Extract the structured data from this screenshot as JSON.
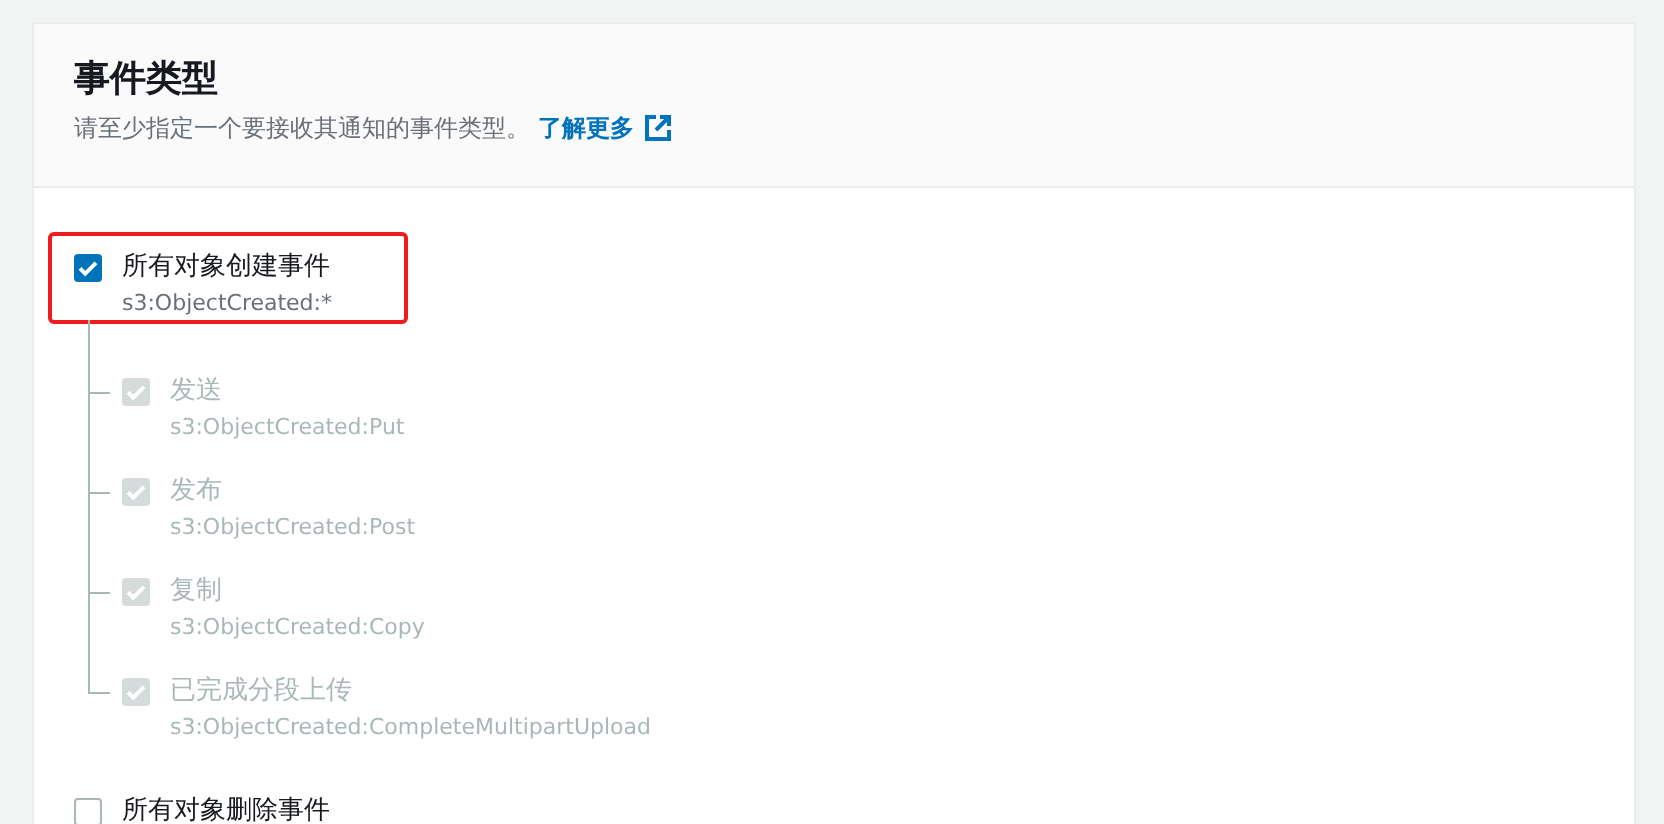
{
  "section": {
    "title": "事件类型",
    "description": "请至少指定一个要接收其通知的事件类型。",
    "link": "了解更多"
  },
  "event_groups": [
    {
      "label": "所有对象创建事件",
      "code": "s3:ObjectCreated:*",
      "checked": true,
      "disabled": false,
      "highlighted": true,
      "children": [
        {
          "label": "发送",
          "code": "s3:ObjectCreated:Put",
          "checked": true,
          "disabled": true
        },
        {
          "label": "发布",
          "code": "s3:ObjectCreated:Post",
          "checked": true,
          "disabled": true
        },
        {
          "label": "复制",
          "code": "s3:ObjectCreated:Copy",
          "checked": true,
          "disabled": true
        },
        {
          "label": "已完成分段上传",
          "code": "s3:ObjectCreated:CompleteMultipartUpload",
          "checked": true,
          "disabled": true
        }
      ]
    },
    {
      "label": "所有对象删除事件",
      "checked": false,
      "disabled": false,
      "highlighted": false
    }
  ]
}
